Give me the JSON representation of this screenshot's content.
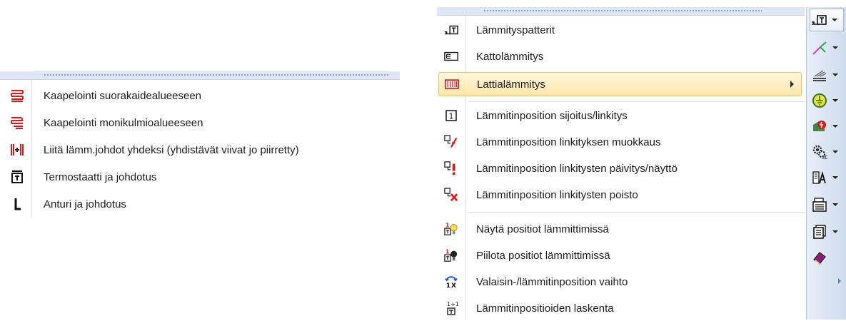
{
  "left_menu": {
    "items": [
      {
        "label": "Kaapelointi suorakaidealueeseen",
        "icon": "red-rectangle-cable-icon"
      },
      {
        "label": "Kaapelointi monikulmioalueeseen",
        "icon": "red-polygon-cable-icon"
      },
      {
        "label": "Liitä lämm.johdot yhdeksi (yhdistävät viivat jo piirretty)",
        "icon": "join-cables-icon"
      },
      {
        "label": "Termostaatti ja johdotus",
        "icon": "thermostat-icon"
      },
      {
        "label": "Anturi ja johdotus",
        "icon": "sensor-icon"
      }
    ]
  },
  "right_menu": {
    "items": [
      {
        "label": "Lämmityspatterit",
        "icon": "radiator-icon"
      },
      {
        "label": "Kattolämmitys",
        "icon": "ceiling-heating-icon"
      },
      {
        "label": "Lattialämmitys",
        "icon": "floor-heating-icon",
        "highlighted": true,
        "submenu": true
      },
      {
        "label": "Lämmitinposition sijoitus/linkitys",
        "icon": "position-number-icon"
      },
      {
        "label": "Lämmitinposition linkityksen muokkaus",
        "icon": "edit-link-icon"
      },
      {
        "label": "Lämmitinposition linkitysten päivitys/näyttö",
        "icon": "update-link-icon"
      },
      {
        "label": "Lämmitinposition linkitysten poisto",
        "icon": "delete-link-icon"
      },
      {
        "label": "Näytä positiot lämmittimissä",
        "icon": "show-positions-icon"
      },
      {
        "label": "Piilota positiot lämmittimissä",
        "icon": "hide-positions-icon"
      },
      {
        "label": "Valaisin-/lämmitinposition vaihto",
        "icon": "swap-positions-icon"
      },
      {
        "label": "Lämmitinpositioiden laskenta",
        "icon": "count-positions-icon"
      }
    ]
  },
  "toolbar": {
    "buttons": [
      {
        "icon": "radiator-tool-icon"
      },
      {
        "icon": "line-tool-icon"
      },
      {
        "icon": "hatch-tool-icon"
      },
      {
        "icon": "ground-symbol-icon"
      },
      {
        "icon": "electric-fault-icon"
      },
      {
        "icon": "settings-3d-icon"
      },
      {
        "icon": "text-style-icon"
      },
      {
        "icon": "equipment-icon"
      },
      {
        "icon": "document-list-icon"
      },
      {
        "icon": "book-icon"
      }
    ]
  }
}
